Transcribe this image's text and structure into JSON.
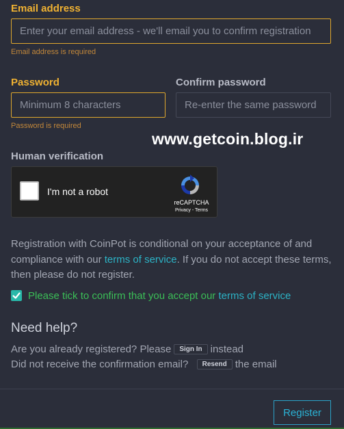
{
  "email": {
    "label": "Email address",
    "placeholder": "Enter your email address - we'll email you to confirm registration",
    "error": "Email address is required"
  },
  "password": {
    "label": "Password",
    "placeholder": "Minimum 8 characters",
    "error": "Password is required"
  },
  "confirm_password": {
    "label": "Confirm password",
    "placeholder": "Re-enter the same password"
  },
  "watermark": "www.getcoin.blog.ir",
  "human_verification": {
    "label": "Human verification",
    "captcha_text": "I'm not a robot",
    "brand": "reCAPTCHA",
    "privacy": "Privacy",
    "separator": " - ",
    "terms": "Terms"
  },
  "terms_notice": {
    "before": "Registration with CoinPot is conditional on your acceptance of and compliance with our ",
    "link": "terms of service",
    "after": ". If you do not accept these terms, then please do not register."
  },
  "accept": {
    "checked": true,
    "text": "Please tick to confirm that you accept our ",
    "link": "terms of service"
  },
  "help": {
    "title": "Need help?",
    "registered_prefix": "Are you already registered?  Please",
    "sign_in": "Sign In",
    "registered_suffix": "instead",
    "confirmation_prefix": "Did not receive the confirmation email?",
    "resend": "Resend",
    "confirmation_suffix": "the email"
  },
  "register_label": "Register",
  "colors": {
    "background": "#2b2e3a",
    "accent": "#f0b232",
    "link": "#2cb3c6",
    "success": "#3bbf57",
    "button": "#2bb3d6"
  }
}
